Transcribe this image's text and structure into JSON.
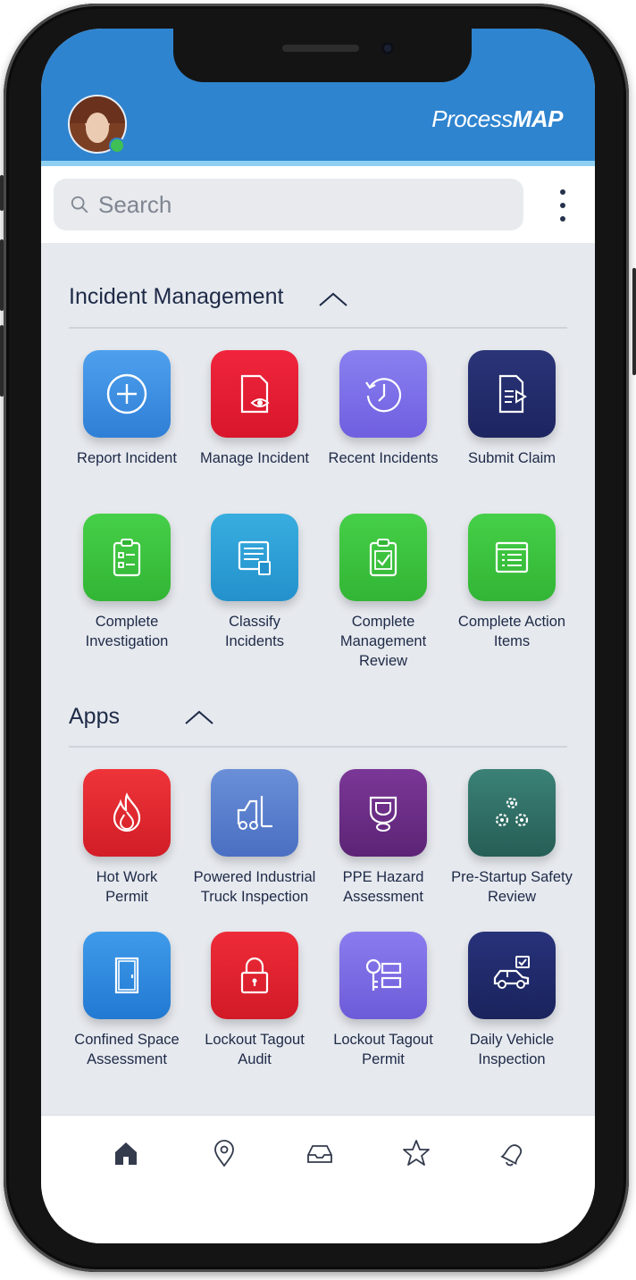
{
  "header": {
    "logo_light": "Process",
    "logo_bold": "MAP"
  },
  "search": {
    "placeholder": "Search"
  },
  "sections": {
    "incident": {
      "title": "Incident Management",
      "tiles": [
        {
          "line1": "Report Incident",
          "line2": "",
          "line3": "",
          "icon": "plus-circle-icon",
          "color": "#3d8fe3"
        },
        {
          "line1": "Manage Incident",
          "line2": "",
          "line3": "",
          "icon": "document-eye-icon",
          "color": "#e81c33"
        },
        {
          "line1": "Recent Incidents",
          "line2": "",
          "line3": "",
          "icon": "history-clock-icon",
          "color": "#7d6fe8"
        },
        {
          "line1": "Submit Claim",
          "line2": "",
          "line3": "",
          "icon": "submit-document-icon",
          "color": "#232c68"
        },
        {
          "line1": "Complete",
          "line2": "Investigation",
          "line3": "",
          "icon": "clipboard-list-icon",
          "color": "#3cc23e"
        },
        {
          "line1": "Classify",
          "line2": "Incidents",
          "line3": "",
          "icon": "classify-document-icon",
          "color": "#2f9fd7"
        },
        {
          "line1": "Complete",
          "line2": "Management",
          "line3": "Review",
          "icon": "clipboard-check-icon",
          "color": "#3cc23e"
        },
        {
          "line1": "Complete Action",
          "line2": "Items",
          "line3": "",
          "icon": "action-list-icon",
          "color": "#3cc23e"
        }
      ]
    },
    "apps": {
      "title": "Apps",
      "tiles": [
        {
          "line1": "Hot Work",
          "line2": "Permit",
          "icon": "flame-icon",
          "color": "#e2272f"
        },
        {
          "line1": "Powered Industrial",
          "line2": "Truck Inspection",
          "icon": "forklift-icon",
          "color": "#5a80cf"
        },
        {
          "line1": "PPE Hazard",
          "line2": "Assessment",
          "icon": "gas-mask-icon",
          "color": "#6a2d86"
        },
        {
          "line1": "Pre-Startup Safety",
          "line2": "Review",
          "icon": "gears-icon",
          "color": "#2f6f65"
        },
        {
          "line1": "Confined Space",
          "line2": "Assessment",
          "icon": "door-icon",
          "color": "#2f8fe0"
        },
        {
          "line1": "Lockout Tagout",
          "line2": "Audit",
          "icon": "padlock-icon",
          "color": "#e2202f"
        },
        {
          "line1": "Lockout Tagout",
          "line2": "Permit",
          "icon": "key-tag-icon",
          "color": "#7b6be2"
        },
        {
          "line1": "Daily Vehicle",
          "line2": "Inspection",
          "icon": "car-check-icon",
          "color": "#1f2b64"
        }
      ]
    }
  },
  "bottom_nav": {
    "items": [
      {
        "icon": "home-icon",
        "active": true
      },
      {
        "icon": "location-pin-icon",
        "active": false
      },
      {
        "icon": "inbox-icon",
        "active": false
      },
      {
        "icon": "star-icon",
        "active": false
      },
      {
        "icon": "bell-icon",
        "active": false
      }
    ]
  }
}
